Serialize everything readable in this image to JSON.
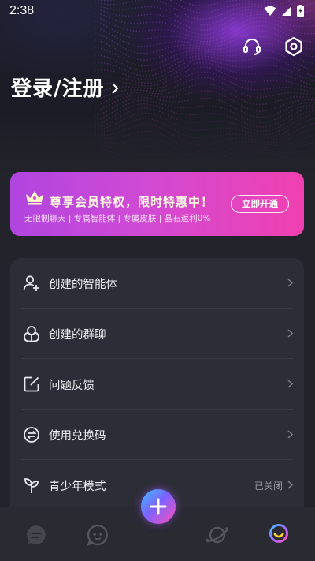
{
  "status": {
    "time": "2:38"
  },
  "header": {
    "login_label": "登录/注册"
  },
  "vip": {
    "title": "尊享会员特权，限时特惠中！",
    "description": "无限制聊天 | 专属智能体 | 专属皮肤 | 晶石返利0%",
    "button_label": "立即开通"
  },
  "menu": {
    "items": [
      {
        "label": "创建的智能体",
        "icon": "add-person-icon"
      },
      {
        "label": "创建的群聊",
        "icon": "group-icon"
      },
      {
        "label": "问题反馈",
        "icon": "feedback-edit-icon"
      },
      {
        "label": "使用兑换码",
        "icon": "exchange-icon"
      },
      {
        "label": "青少年模式",
        "icon": "sprout-icon",
        "state": "已关闭"
      }
    ]
  },
  "colors": {
    "accent_start": "#b045e0",
    "accent_end": "#f040b0",
    "background": "#23232b"
  }
}
